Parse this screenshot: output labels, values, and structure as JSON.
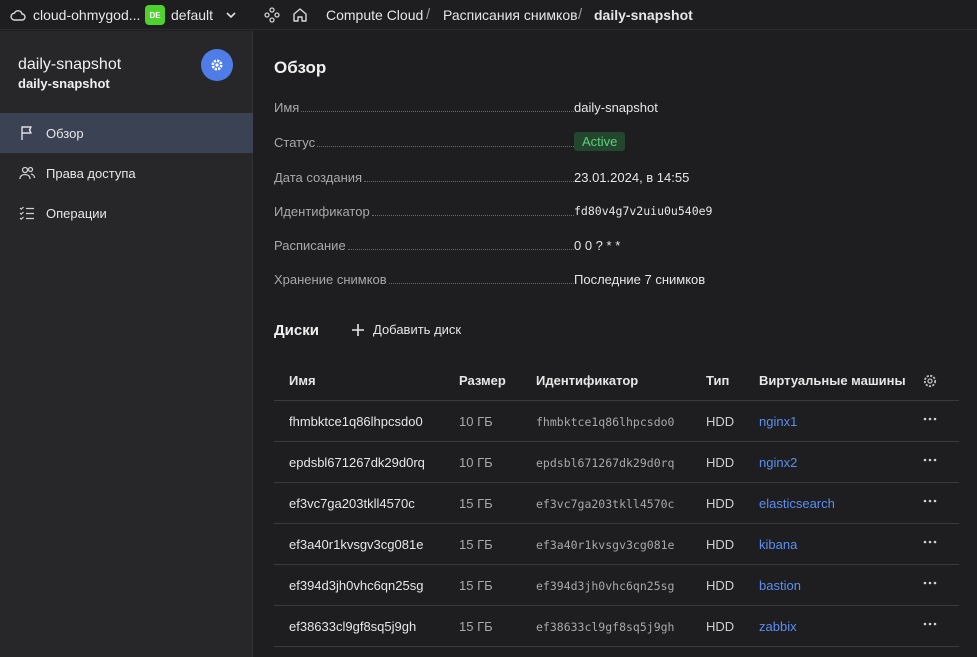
{
  "topbar": {
    "cloud_name": "cloud-ohmygod...",
    "folder_badge": "DE",
    "folder_name": "default",
    "crumbs": [
      "Compute Cloud",
      "Расписания снимков",
      "daily-snapshot"
    ]
  },
  "sidebar": {
    "title": "daily-snapshot",
    "subtitle": "daily-snapshot",
    "items": [
      {
        "label": "Обзор",
        "icon": "flag-icon",
        "active": true
      },
      {
        "label": "Права доступа",
        "icon": "users-icon",
        "active": false
      },
      {
        "label": "Операции",
        "icon": "list-icon",
        "active": false
      }
    ]
  },
  "overview": {
    "title": "Обзор",
    "props": [
      {
        "label": "Имя",
        "value": "daily-snapshot"
      },
      {
        "label": "Статус",
        "value": "Active"
      },
      {
        "label": "Дата создания",
        "value": "23.01.2024, в 14:55"
      },
      {
        "label": "Идентификатор",
        "value": "fd80v4g7v2uiu0u540e9"
      },
      {
        "label": "Расписание",
        "value": "0 0 ? * *"
      },
      {
        "label": "Хранение снимков",
        "value": "Последние 7 снимков"
      }
    ]
  },
  "disks": {
    "title": "Диски",
    "add_label": "Добавить диск",
    "columns": [
      "Имя",
      "Размер",
      "Идентификатор",
      "Тип",
      "Виртуальные машины"
    ],
    "rows": [
      {
        "name": "fhmbktce1q86lhpcsdo0",
        "size": "10 ГБ",
        "id": "fhmbktce1q86lhpcsdo0",
        "type": "HDD",
        "vm": "nginx1"
      },
      {
        "name": "epdsbl671267dk29d0rq",
        "size": "10 ГБ",
        "id": "epdsbl671267dk29d0rq",
        "type": "HDD",
        "vm": "nginx2"
      },
      {
        "name": "ef3vc7ga203tkll4570c",
        "size": "15 ГБ",
        "id": "ef3vc7ga203tkll4570c",
        "type": "HDD",
        "vm": "elasticsearch"
      },
      {
        "name": "ef3a40r1kvsgv3cg081e",
        "size": "15 ГБ",
        "id": "ef3a40r1kvsgv3cg081e",
        "type": "HDD",
        "vm": "kibana"
      },
      {
        "name": "ef394d3jh0vhc6qn25sg",
        "size": "15 ГБ",
        "id": "ef394d3jh0vhc6qn25sg",
        "type": "HDD",
        "vm": "bastion"
      },
      {
        "name": "ef38633cl9gf8sq5j9gh",
        "size": "15 ГБ",
        "id": "ef38633cl9gf8sq5j9gh",
        "type": "HDD",
        "vm": "zabbix"
      }
    ]
  },
  "colors": {
    "background": "#1e1e20",
    "sidebar": "#27272a",
    "active_item": "#3a4254",
    "accent": "#4f7de8",
    "link": "#5a8ef0",
    "status_active": "#5fcf7a",
    "folder_badge": "#4fd12e"
  }
}
